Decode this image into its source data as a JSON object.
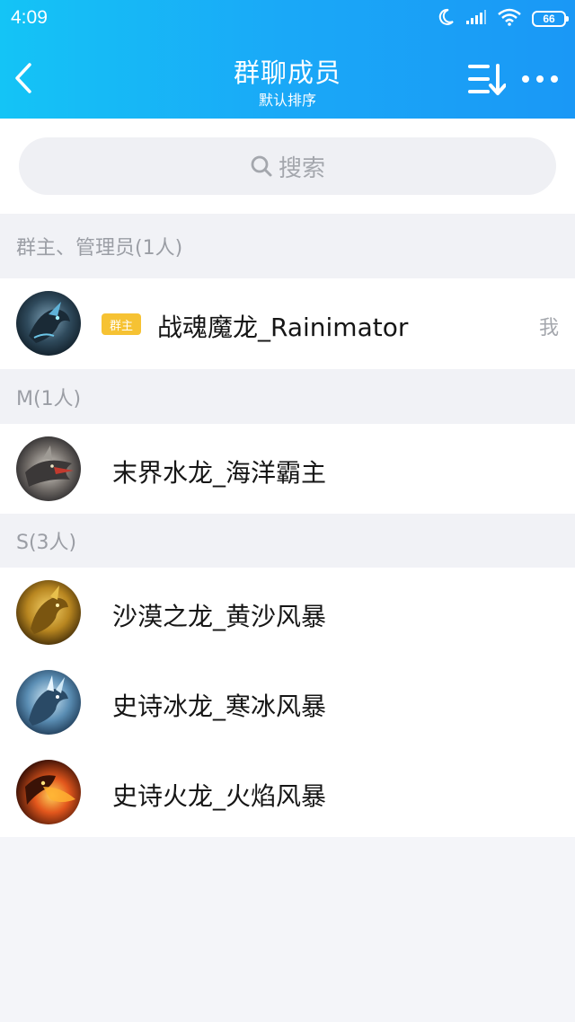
{
  "status_bar": {
    "time": "4:09",
    "battery": "66",
    "icons": [
      "moon-icon",
      "signal-icon",
      "wifi-icon",
      "battery-icon"
    ]
  },
  "nav": {
    "title": "群聊成员",
    "subtitle": "默认排序",
    "back_icon": "chevron-left-icon",
    "sort_icon": "sort-icon",
    "more_icon": "more-dots-icon"
  },
  "search": {
    "placeholder": "搜索",
    "icon": "search-icon"
  },
  "sections": [
    {
      "header": "群主、管理员(1人)",
      "members": [
        {
          "name": "战魂魔龙_Rainimator",
          "badge": "群主",
          "tag": "我"
        }
      ]
    },
    {
      "header": "M(1人)",
      "members": [
        {
          "name": "末界水龙_海洋霸主"
        }
      ]
    },
    {
      "header": "S(3人)",
      "members": [
        {
          "name": "沙漠之龙_黄沙风暴"
        },
        {
          "name": "史诗冰龙_寒冰风暴"
        },
        {
          "name": "史诗火龙_火焰风暴"
        }
      ]
    }
  ],
  "colors": {
    "header_gradient_start": "#14c4f6",
    "header_gradient_end": "#1a98f6",
    "badge": "#f6c233",
    "section_bg": "#f1f2f6",
    "page_bg": "#f4f5f9"
  }
}
